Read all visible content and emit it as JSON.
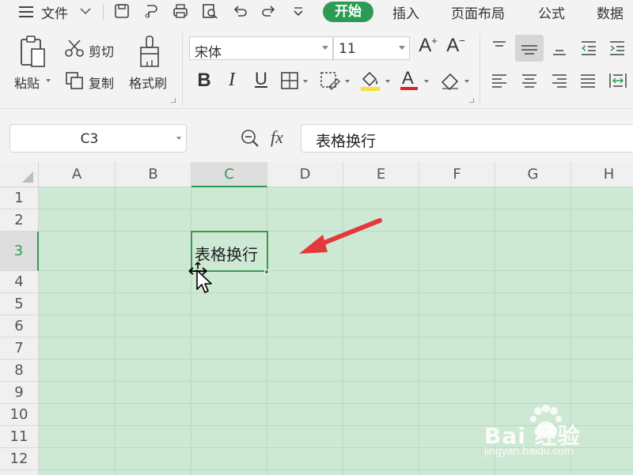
{
  "menubar": {
    "menu_icon": "hamburger-icon",
    "file_label": "文件",
    "tabs": [
      "开始",
      "插入",
      "页面布局",
      "公式",
      "数据"
    ]
  },
  "ribbon": {
    "paste": "粘贴",
    "cut": "剪切",
    "copy": "复制",
    "format_painter": "格式刷",
    "font_name": "宋体",
    "font_size": "11",
    "bold": "B",
    "italic": "I",
    "underline": "U"
  },
  "formula_bar": {
    "name_box": "C3",
    "fx": "fx",
    "content": "表格换行"
  },
  "sheet": {
    "columns": [
      "A",
      "B",
      "C",
      "D",
      "E",
      "F",
      "G",
      "H"
    ],
    "rows": [
      "1",
      "2",
      "3",
      "4",
      "5",
      "6",
      "7",
      "8",
      "9",
      "10",
      "11",
      "12"
    ],
    "selected_column": "C",
    "selected_row": "3",
    "active_cell_value": "表格换行"
  },
  "watermark": {
    "brand": "Bai 经验",
    "url": "jingyan.baidu.com"
  },
  "colors": {
    "accent": "#2e9b55",
    "sheet_bg": "#cde8d3",
    "arrow": "#e5383b"
  }
}
